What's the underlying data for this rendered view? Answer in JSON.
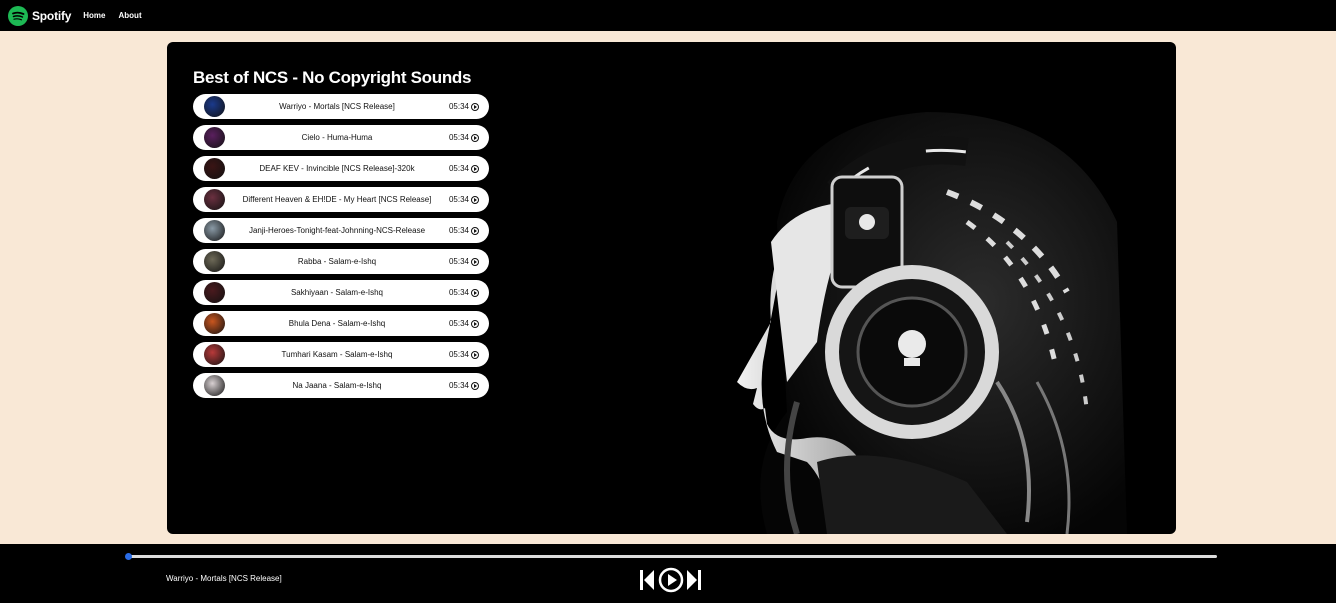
{
  "navbar": {
    "brand": "Spotify",
    "links": [
      "Home",
      "About"
    ]
  },
  "playlist": {
    "title": "Best of NCS - No Copyright Sounds",
    "songs": [
      {
        "name": "Warriyo - Mortals [NCS Release]",
        "duration": "05:34",
        "thumb_color": "#1b3a8c"
      },
      {
        "name": "Cielo - Huma-Huma",
        "duration": "05:34",
        "thumb_color": "#5a1f5e"
      },
      {
        "name": "DEAF KEV - Invincible [NCS Release]-320k",
        "duration": "05:34",
        "thumb_color": "#3a1414"
      },
      {
        "name": "Different Heaven & EH!DE - My Heart [NCS Release]",
        "duration": "05:34",
        "thumb_color": "#6b3040"
      },
      {
        "name": "Janji-Heroes-Tonight-feat-Johnning-NCS-Release",
        "duration": "05:34",
        "thumb_color": "#8a9aa6"
      },
      {
        "name": "Rabba - Salam-e-Ishq",
        "duration": "05:34",
        "thumb_color": "#6e6a58"
      },
      {
        "name": "Sakhiyaan - Salam-e-Ishq",
        "duration": "05:34",
        "thumb_color": "#4a1a1e"
      },
      {
        "name": "Bhula Dena - Salam-e-Ishq",
        "duration": "05:34",
        "thumb_color": "#c9561f"
      },
      {
        "name": "Tumhari Kasam - Salam-e-Ishq",
        "duration": "05:34",
        "thumb_color": "#b83a3a"
      },
      {
        "name": "Na Jaana - Salam-e-Ishq",
        "duration": "05:34",
        "thumb_color": "#d8d0d2"
      }
    ]
  },
  "player": {
    "now_playing": "Warriyo - Mortals [NCS Release]",
    "progress_percent": 0,
    "controls": [
      "previous-icon",
      "play-icon",
      "next-icon"
    ]
  },
  "colors": {
    "page_bg": "#f9e8d6",
    "brand_green": "#1db954",
    "progress_accent": "#2a6ce6"
  }
}
